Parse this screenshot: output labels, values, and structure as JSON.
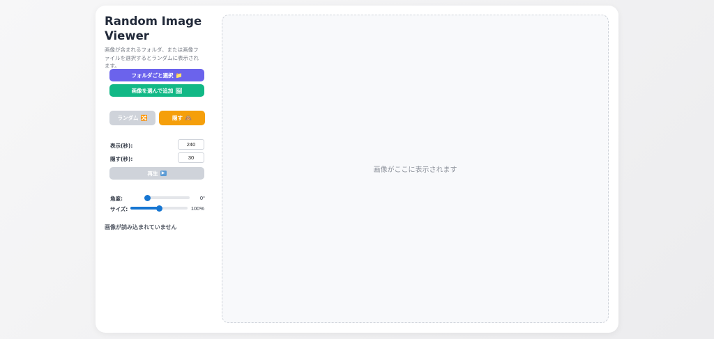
{
  "app": {
    "title": "Random Image Viewer",
    "description": "画像が含まれるフォルダ、または画像ファイルを選択するとランダムに表示されます。"
  },
  "buttons": {
    "folder_label": "フォルダごと選択",
    "folder_icon": "📁",
    "add_label": "画像を選んで追加",
    "add_icon": "🖼",
    "random_label": "ランダム",
    "random_icon": "🔀",
    "hide_label": "隠す",
    "hide_icon": "🙈",
    "play_label": "再生",
    "play_icon": "▶"
  },
  "timing": {
    "show_label": "表示(秒):",
    "show_value": "240",
    "hide_label": "隠す(秒):",
    "hide_value": "30"
  },
  "sliders": {
    "angle_label": "角度:",
    "angle_value": "0°",
    "angle_fraction": 0.0,
    "size_label": "サイズ:",
    "size_value": "100%",
    "size_fraction": 0.5
  },
  "status": "画像が読み込まれていません",
  "viewer": {
    "placeholder": "画像がここに表示されます"
  },
  "colors": {
    "folder_button": "#6b63ec",
    "add_button": "#12b886",
    "hide_button": "#f59f0b",
    "disabled_button": "#cfd3da",
    "slider_accent": "#1676d2"
  }
}
